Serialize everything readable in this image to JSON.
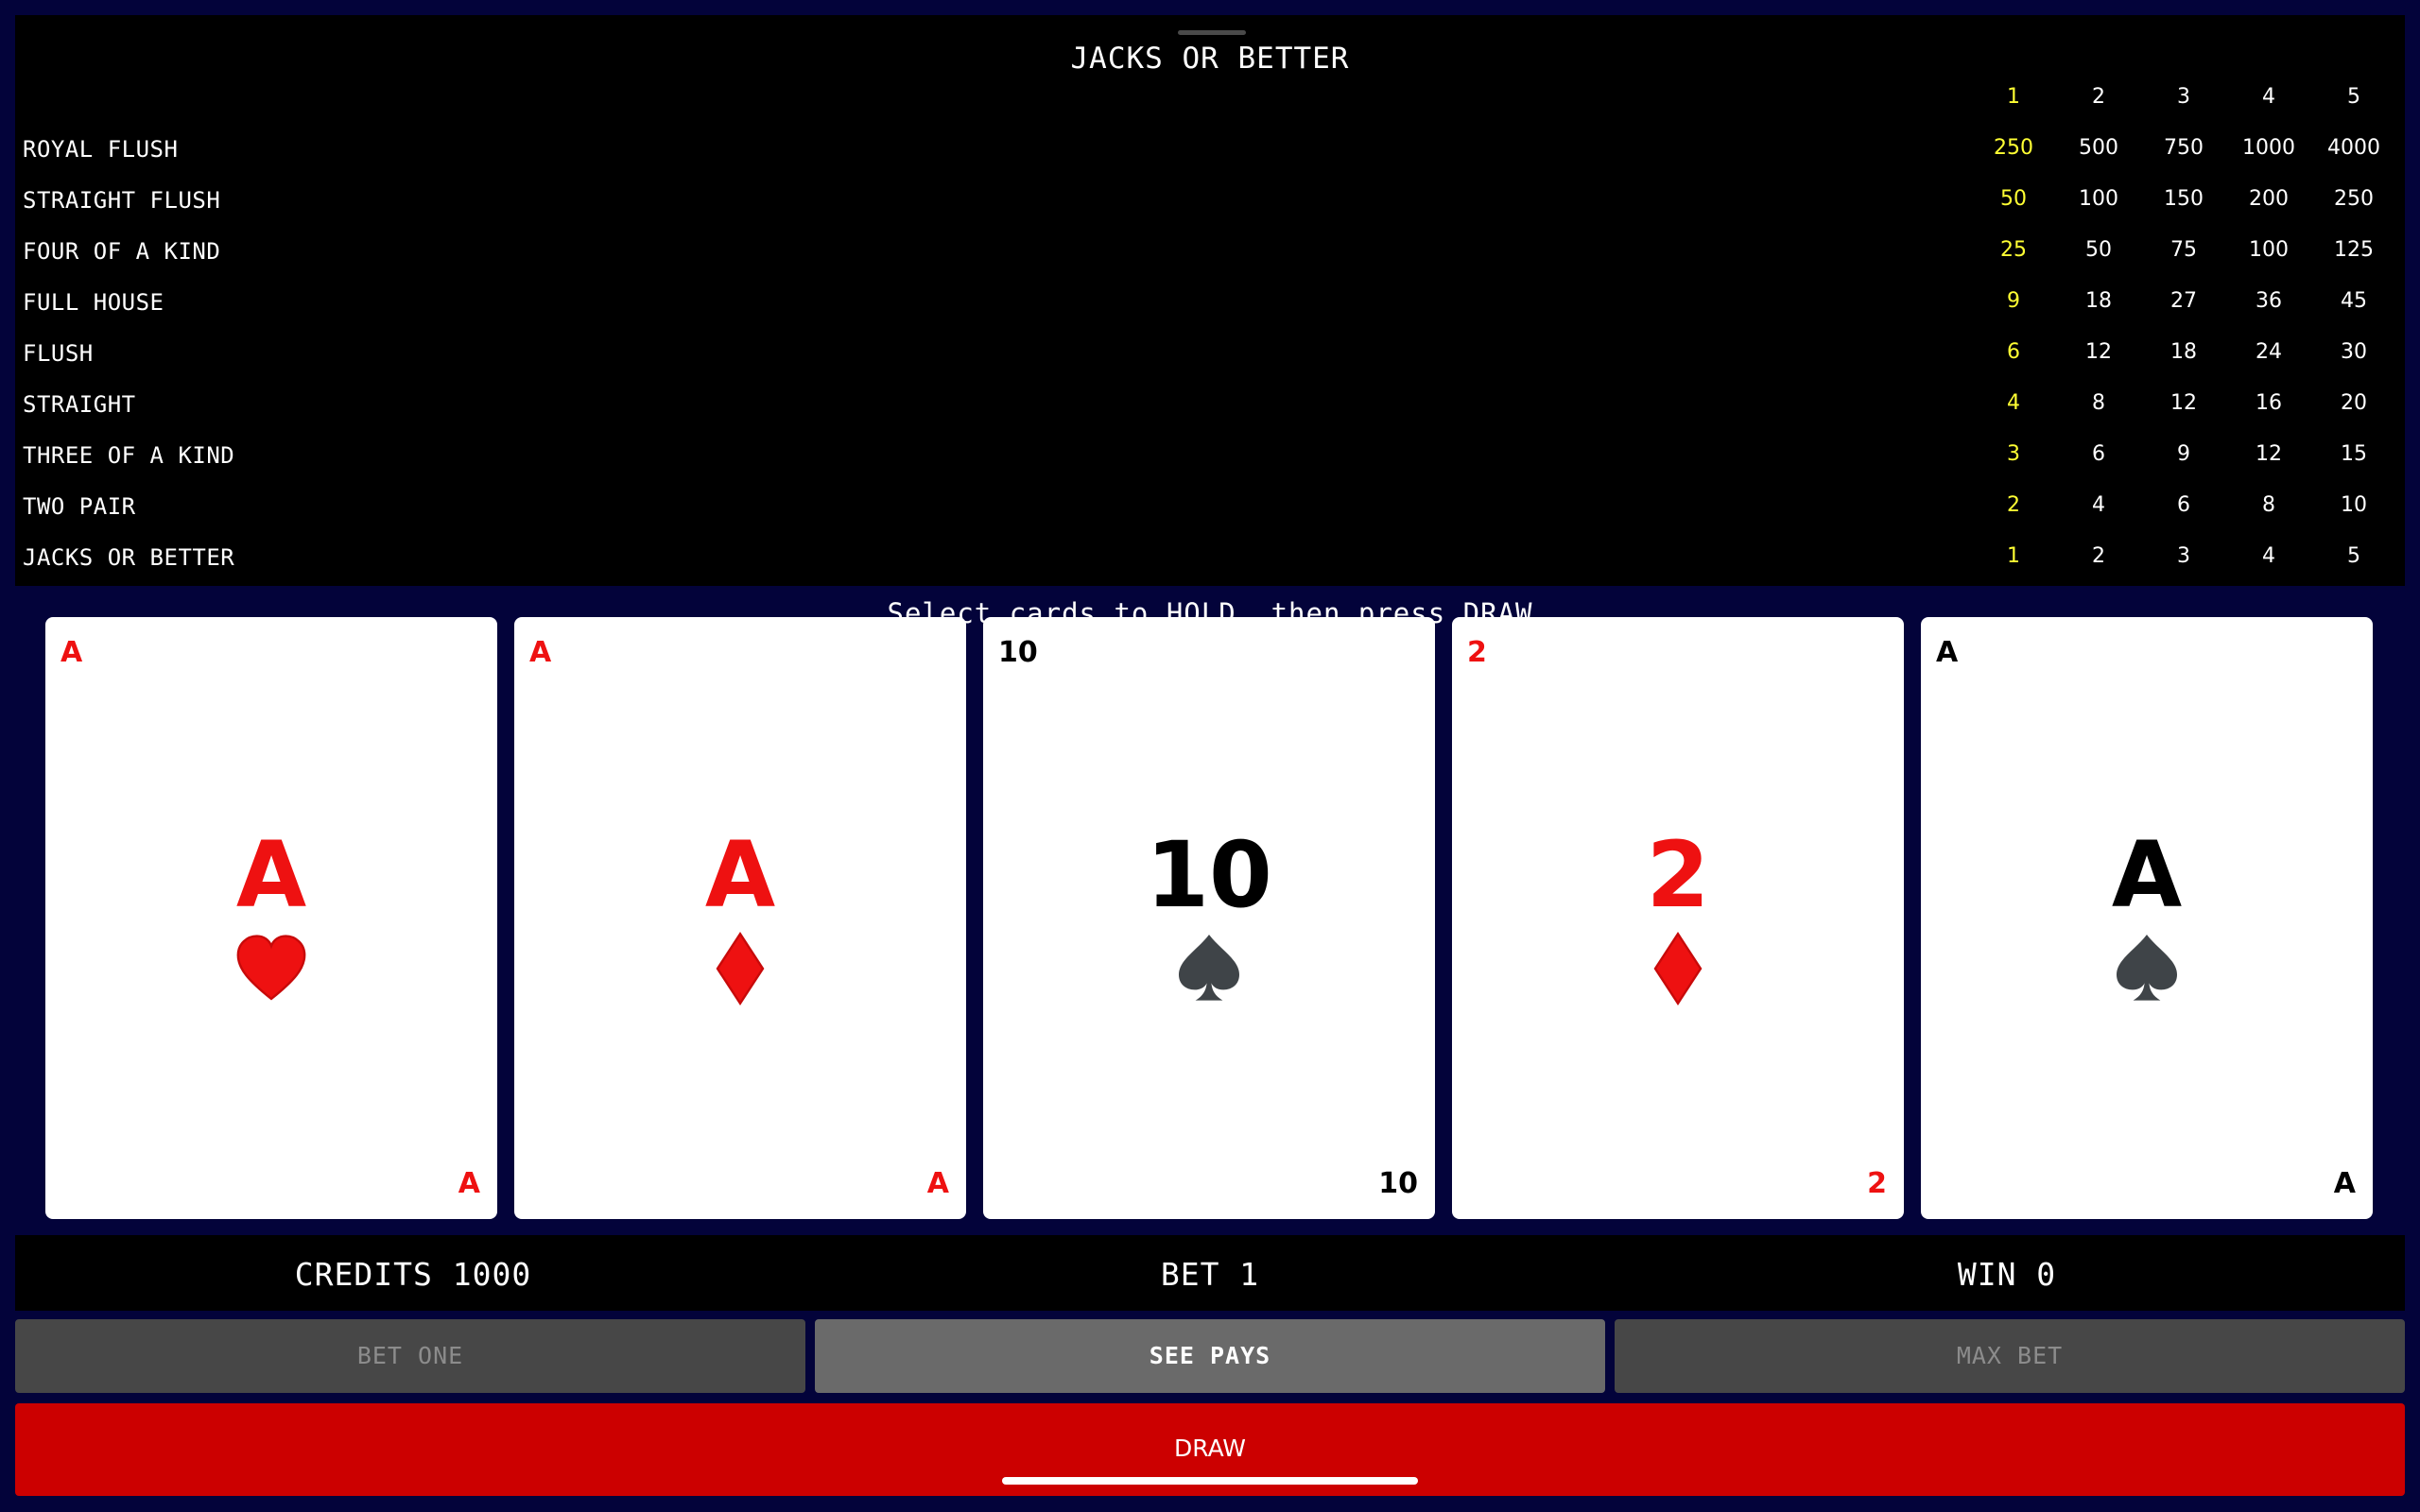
{
  "paytable": {
    "title": "JACKS OR BETTER",
    "bet_columns": [
      "1",
      "2",
      "3",
      "4",
      "5"
    ],
    "active_column": 0,
    "rows": [
      {
        "hand": "ROYAL FLUSH",
        "pays": [
          "250",
          "500",
          "750",
          "1000",
          "4000"
        ]
      },
      {
        "hand": "STRAIGHT FLUSH",
        "pays": [
          "50",
          "100",
          "150",
          "200",
          "250"
        ]
      },
      {
        "hand": "FOUR OF A KIND",
        "pays": [
          "25",
          "50",
          "75",
          "100",
          "125"
        ]
      },
      {
        "hand": "FULL HOUSE",
        "pays": [
          "9",
          "18",
          "27",
          "36",
          "45"
        ]
      },
      {
        "hand": "FLUSH",
        "pays": [
          "6",
          "12",
          "18",
          "24",
          "30"
        ]
      },
      {
        "hand": "STRAIGHT",
        "pays": [
          "4",
          "8",
          "12",
          "16",
          "20"
        ]
      },
      {
        "hand": "THREE OF A KIND",
        "pays": [
          "3",
          "6",
          "9",
          "12",
          "15"
        ]
      },
      {
        "hand": "TWO PAIR",
        "pays": [
          "2",
          "4",
          "6",
          "8",
          "10"
        ]
      },
      {
        "hand": "JACKS OR BETTER",
        "pays": [
          "1",
          "2",
          "3",
          "4",
          "5"
        ]
      }
    ]
  },
  "hint": "Select cards to HOLD, then press DRAW",
  "cards": [
    {
      "rank": "A",
      "suit": "heart-icon",
      "color": "#ee1111"
    },
    {
      "rank": "A",
      "suit": "diamond-icon",
      "color": "#ee1111"
    },
    {
      "rank": "10",
      "suit": "spade-icon",
      "color": "#000000"
    },
    {
      "rank": "2",
      "suit": "diamond-icon",
      "color": "#ee1111"
    },
    {
      "rank": "A",
      "suit": "spade-icon",
      "color": "#000000"
    }
  ],
  "status": {
    "credits": "CREDITS 1000",
    "bet": "BET 1",
    "win": "WIN 0"
  },
  "buttons": {
    "bet_one": "BET ONE",
    "see_pays": "SEE PAYS",
    "max_bet": "MAX BET",
    "draw": "DRAW"
  },
  "colors": {
    "background": "#03033a",
    "active_pay": "#ffff33",
    "card_red": "#ee1111",
    "draw_button": "#cc0000"
  }
}
